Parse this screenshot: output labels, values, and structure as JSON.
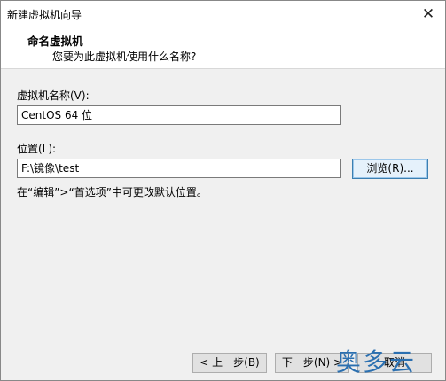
{
  "window": {
    "title": "新建虚拟机向导",
    "close_glyph": "✕"
  },
  "header": {
    "title": "命名虚拟机",
    "subtitle": "您要为此虚拟机使用什么名称?"
  },
  "form": {
    "name_label": "虚拟机名称(V):",
    "name_value": "CentOS 64 位",
    "location_label": "位置(L):",
    "location_value": "F:\\镜像\\test",
    "browse_label": "浏览(R)...",
    "hint": "在“编辑”>“首选项”中可更改默认位置。"
  },
  "footer": {
    "back_label": "< 上一步(B)",
    "next_label": "下一步(N) >",
    "cancel_label": "取消"
  },
  "watermark": {
    "text": "奥多云"
  }
}
